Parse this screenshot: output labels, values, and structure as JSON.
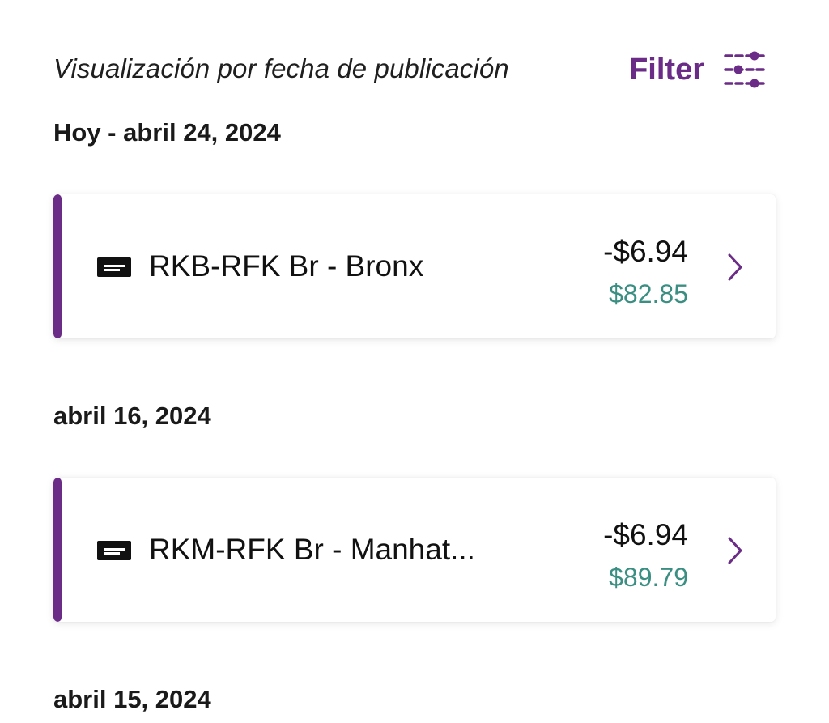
{
  "header": {
    "sort_label": "Visualización por fecha de publicación",
    "filter_label": "Filter",
    "filter_icon": "sliders-filter-icon"
  },
  "groups": [
    {
      "date": "Hoy - abril 24, 2024",
      "transactions": [
        {
          "icon": "tag-label-icon",
          "title": "RKB-RFK Br - Bronx",
          "amount": "-$6.94",
          "balance": "$82.85"
        }
      ]
    },
    {
      "date": "abril 16, 2024",
      "transactions": [
        {
          "icon": "tag-label-icon",
          "title": "RKM-RFK Br - Manhat...",
          "amount": "-$6.94",
          "balance": "$89.79"
        }
      ]
    },
    {
      "date": "abril 15, 2024",
      "transactions": []
    }
  ],
  "colors": {
    "accent": "#6a2c86",
    "balance": "#3b8f82",
    "text": "#1a1a1a"
  }
}
